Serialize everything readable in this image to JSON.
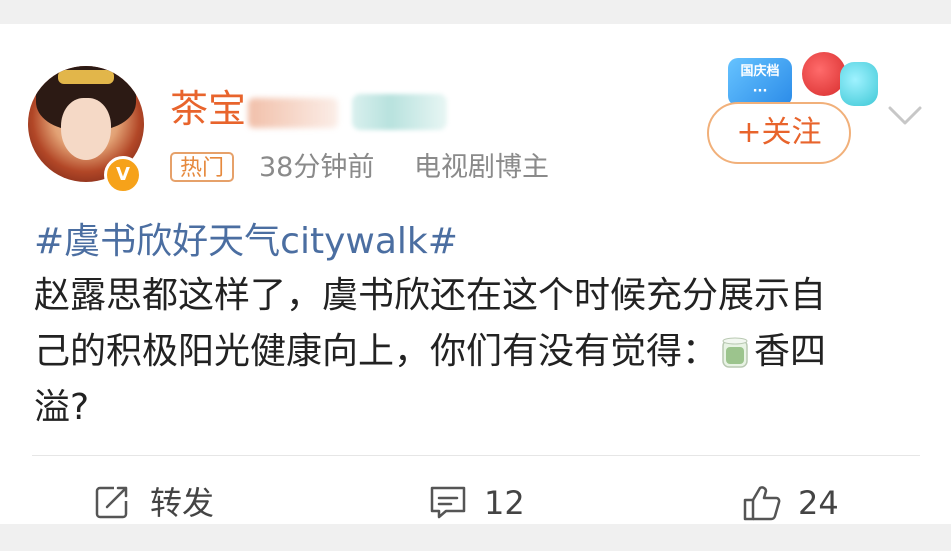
{
  "post": {
    "author": {
      "name": "茶宝",
      "verified_badge": "V",
      "hot_tag": "热门",
      "time": "38分钟前",
      "role": "电视剧博主"
    },
    "promo_badge_text": "国庆档 (blurred)",
    "follow_label": "+关注",
    "hashtag": "#虞书欣好天气citywalk#",
    "content_lines": [
      "赵露思都这样了，虞书欣还在这个时候充分展示自",
      "己的积极阳光健康向上，你们有没有觉得：",
      "溢?"
    ],
    "content_after_icon": "香四",
    "icons": {
      "tea": "tea-cup-icon",
      "repost": "repost-icon",
      "comment": "comment-icon",
      "like": "thumbs-up-icon",
      "more": "chevron-down-icon"
    },
    "actions": {
      "repost_label": "转发",
      "comment_count": "12",
      "like_count": "24"
    }
  },
  "colors": {
    "accent": "#e8642c",
    "hashtag": "#4b6ea1",
    "meta": "#8a8a8a"
  }
}
